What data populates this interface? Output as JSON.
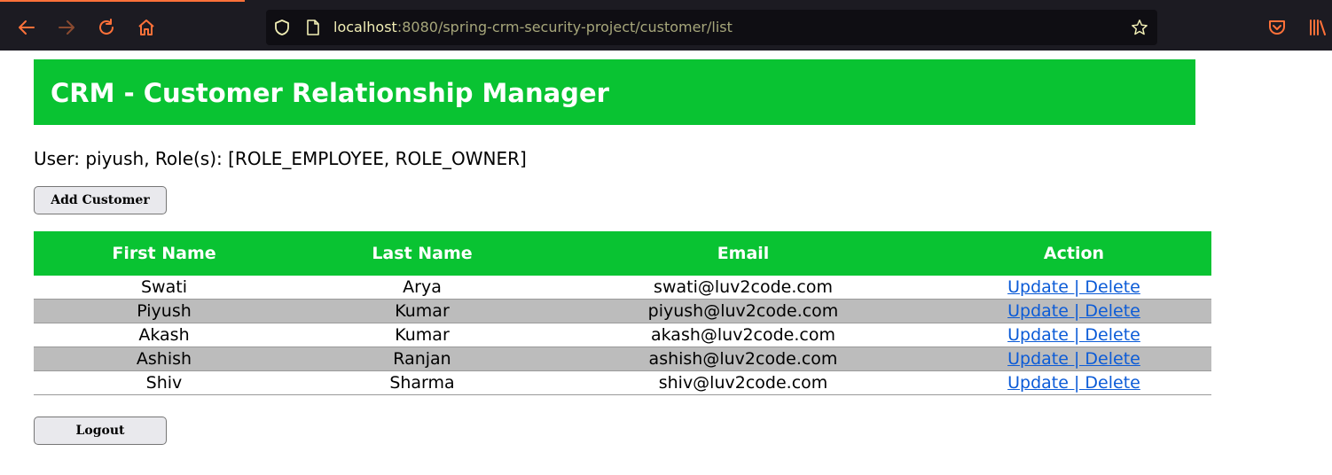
{
  "browser": {
    "url_host": "localhost",
    "url_rest": ":8080/spring-crm-security-project/customer/list",
    "colors": {
      "chrome_bg": "#1c1b22",
      "accent": "#ff7139"
    },
    "icons": [
      "back-icon",
      "forward-icon",
      "reload-icon",
      "home-icon",
      "shield-icon",
      "page-icon",
      "star-icon",
      "pocket-icon",
      "library-icon"
    ]
  },
  "header": {
    "title": "CRM - Customer Relationship Manager",
    "color": "#09c332"
  },
  "user_line": "User: piyush, Role(s): [ROLE_EMPLOYEE, ROLE_OWNER]",
  "add_button": "Add Customer",
  "logout_button": "Logout",
  "table": {
    "headers": [
      "First Name",
      "Last Name",
      "Email",
      "Action"
    ],
    "rows": [
      {
        "first": "Swati",
        "last": "Arya",
        "email": "swati@luv2code.com",
        "update": "Update",
        "sep": " | ",
        "delete": "Delete"
      },
      {
        "first": "Piyush",
        "last": "Kumar",
        "email": "piyush@luv2code.com",
        "update": "Update",
        "sep": " | ",
        "delete": "Delete"
      },
      {
        "first": "Akash",
        "last": "Kumar",
        "email": "akash@luv2code.com",
        "update": "Update",
        "sep": " | ",
        "delete": "Delete"
      },
      {
        "first": "Ashish",
        "last": "Ranjan",
        "email": "ashish@luv2code.com",
        "update": "Update",
        "sep": " | ",
        "delete": "Delete"
      },
      {
        "first": "Shiv",
        "last": "Sharma",
        "email": "shiv@luv2code.com",
        "update": "Update",
        "sep": " | ",
        "delete": "Delete"
      }
    ]
  }
}
